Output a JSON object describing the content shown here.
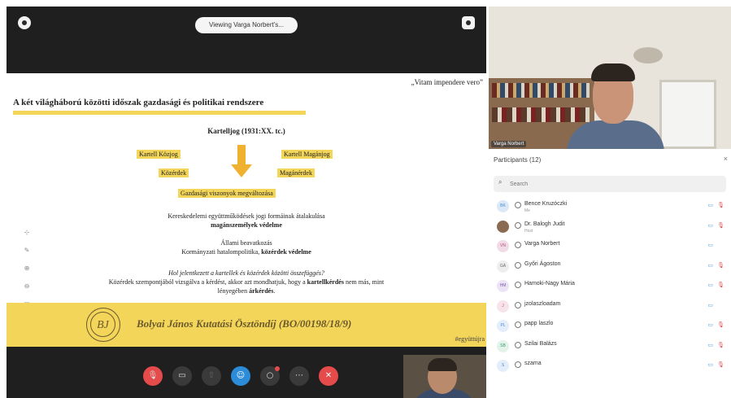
{
  "toolbar": {
    "viewing_label": "Viewing Varga Norbert's..."
  },
  "slide": {
    "quote": "„Vitam impendere vero”",
    "title": "A két világháború közötti időszak gazdasági és politikai rendszere",
    "cartel_heading": "Kartelljog (1931:XX. tc.)",
    "tag_kartell_kozjog": "Kartell Közjog",
    "tag_kartell_maganjog": "Kartell Magánjog",
    "tag_kozerdek": "Közérdek",
    "tag_maganerdek": "Magánérdek",
    "tag_gazdasagi": "Gazdasági viszonyok megváltozása",
    "para1_line1": "Kereskedelemi együttműködések jogi formáinak átalakulása",
    "para1_line2": "magánszemélyek védelme",
    "para2_line1": "Állami beavatkozás",
    "para2_line2_a": "Kormányzati hatalompolitika, ",
    "para2_line2_b": "közérdek védelme",
    "para3_line1": "Hol jelentkezett a kartellek és közérdek közötti összefüggés?",
    "para3_line2_a": "Közérdek szempontjából vizsgálva a kérdést, akkor azt mondhatjuk, hogy a ",
    "para3_line2_b": "kartellkérdés",
    "para3_line2_c": " nem más, mint",
    "para3_line3_a": "lényegében ",
    "para3_line3_b": "árkérdés",
    "para3_line3_c": ".",
    "banner_logo": "BJ",
    "banner_text": "Bolyai János Kutatási Ösztöndíj (BO/00198/18/9)",
    "banner_tag": "#együttújra"
  },
  "camera": {
    "name_label": "Varga Norbert"
  },
  "panel": {
    "header": "Participants (12)",
    "search_placeholder": "Search",
    "participants": [
      {
        "initials": "BK",
        "name": "Bence Kruzóczki",
        "role": "Me",
        "avatar_color": "#dbe8f7",
        "text_color": "#4a8ad8",
        "mic": true
      },
      {
        "initials": "",
        "name": "Dr. Balogh Judit",
        "role": "Host",
        "avatar_color": "#8b6a52",
        "text_color": "#ffffff",
        "mic": true
      },
      {
        "initials": "VN",
        "name": "Varga Norbert",
        "role": "",
        "avatar_color": "#f1dbe6",
        "text_color": "#b6507e",
        "mic": false
      },
      {
        "initials": "GÁ",
        "name": "Győri Ágoston",
        "role": "",
        "avatar_color": "#eeeeee",
        "text_color": "#666666",
        "mic": true
      },
      {
        "initials": "HM",
        "name": "Hamoki-Nagy Mária",
        "role": "",
        "avatar_color": "#ece4f6",
        "text_color": "#7b5ab5",
        "mic": true
      },
      {
        "initials": "J",
        "name": "jzolaszloadam",
        "role": "",
        "avatar_color": "#f7e4ea",
        "text_color": "#c0507a",
        "mic": false
      },
      {
        "initials": "PL",
        "name": "papp laszlo",
        "role": "",
        "avatar_color": "#e3eefa",
        "text_color": "#4a8ad8",
        "mic": true
      },
      {
        "initials": "SB",
        "name": "Szilai Balázs",
        "role": "",
        "avatar_color": "#e3f3ea",
        "text_color": "#3a9a6a",
        "mic": true
      },
      {
        "initials": "S",
        "name": "szama",
        "role": "",
        "avatar_color": "#e3eefa",
        "text_color": "#4a8ad8",
        "mic": true
      }
    ]
  }
}
